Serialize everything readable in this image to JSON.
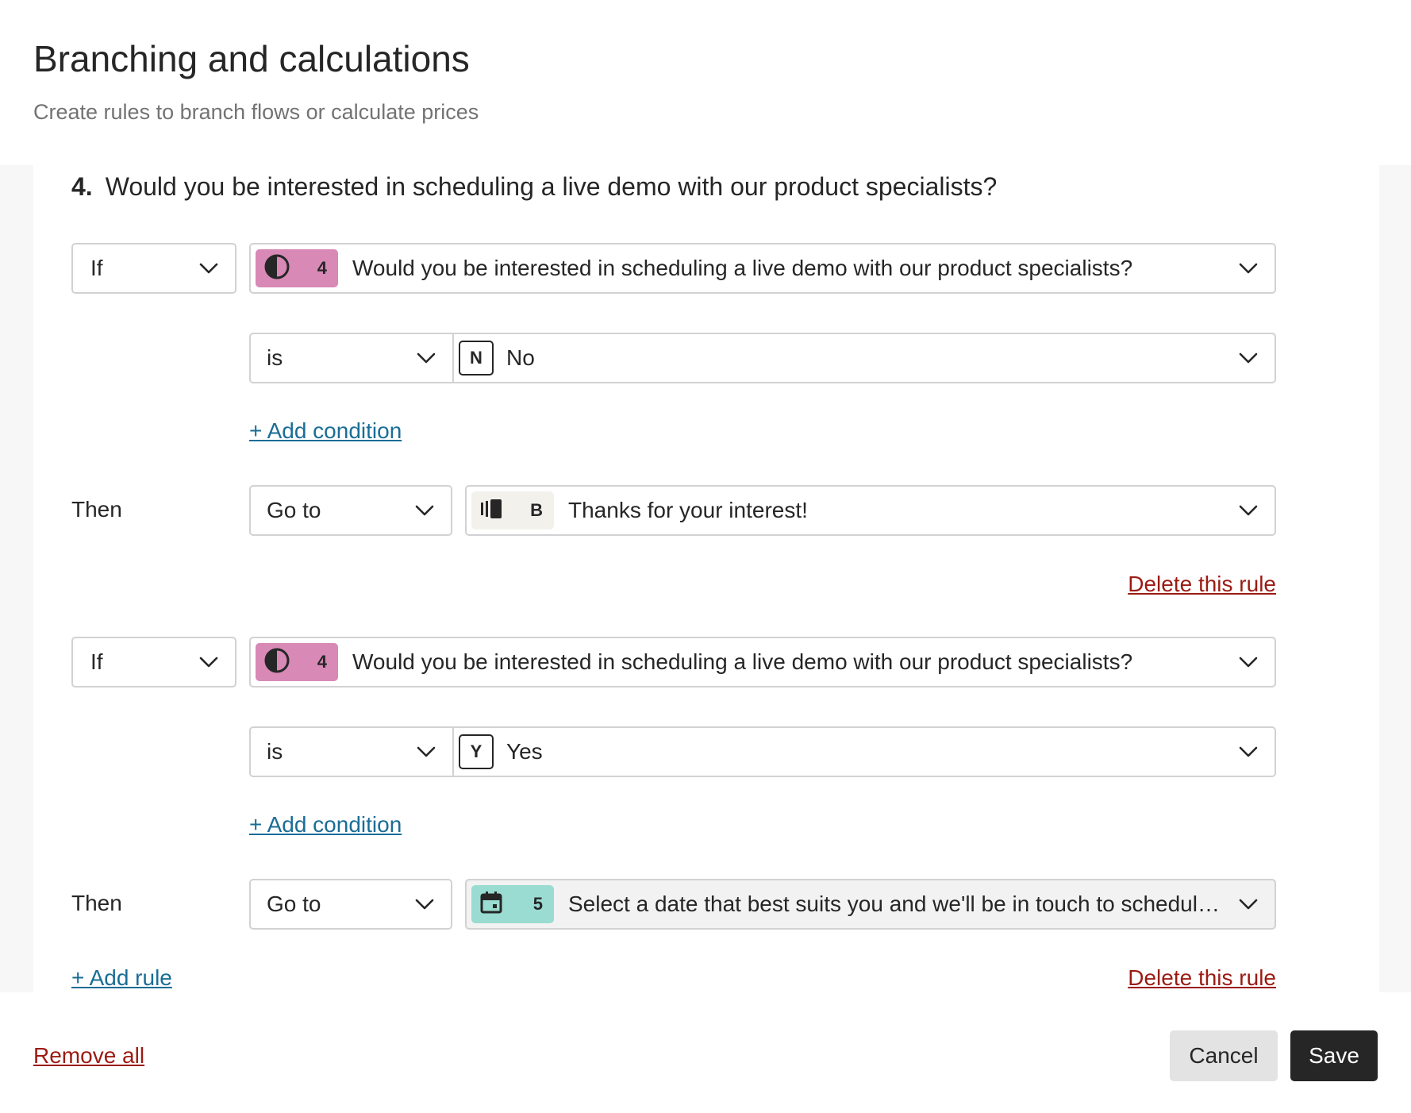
{
  "header": {
    "title": "Branching and calculations",
    "subtitle": "Create rules to branch flows or calculate prices"
  },
  "question": {
    "number": "4.",
    "text": "Would you be interested in scheduling a live demo with our product specialists?"
  },
  "rules": [
    {
      "if_label": "If",
      "condition_question_number": "4",
      "condition_question_text": "Would you be interested in scheduling a live demo with our product specialists?",
      "operator": "is",
      "value_key": "N",
      "value_text": "No",
      "add_condition_label": "+ Add condition",
      "then_label": "Then",
      "action": "Go to",
      "target_badge": "B",
      "target_text": "Thanks for your interest!",
      "delete_label": "Delete this rule"
    },
    {
      "if_label": "If",
      "condition_question_number": "4",
      "condition_question_text": "Would you be interested in scheduling a live demo with our product specialists?",
      "operator": "is",
      "value_key": "Y",
      "value_text": "Yes",
      "add_condition_label": "+ Add condition",
      "then_label": "Then",
      "action": "Go to",
      "target_badge": "5",
      "target_text": "Select a date that best suits you and we'll be in touch to schedule a demo",
      "delete_label": "Delete this rule"
    }
  ],
  "add_rule_label": "+ Add rule",
  "footer": {
    "remove_all_label": "Remove all",
    "cancel_label": "Cancel",
    "save_label": "Save"
  },
  "icons": {
    "opinion_scale": "half-circle-icon",
    "statement": "statement-block-icon",
    "calendar": "calendar-icon",
    "chevron": "chevron-down-icon"
  },
  "colors": {
    "pink_chip": "#d889b5",
    "beige_chip": "#f3f1ec",
    "teal_chip": "#9adcd1",
    "link_blue": "#1a6d96",
    "link_red": "#9b1b13",
    "primary_button": "#262627"
  }
}
